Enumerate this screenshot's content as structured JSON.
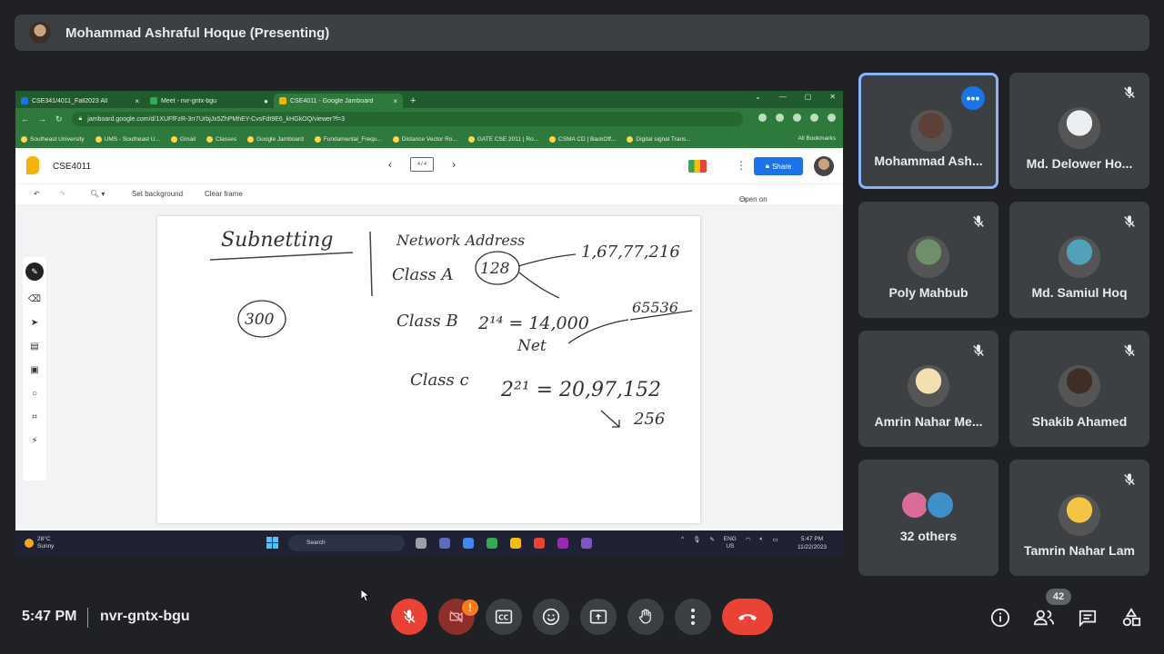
{
  "presenter": {
    "label": "Mohammad Ashraful Hoque (Presenting)"
  },
  "browser": {
    "tabs": [
      {
        "label": "CSE341/4011_Fall2023 All",
        "favicon_color": "#1a73e8",
        "active": false
      },
      {
        "label": "Meet - nvr-gntx-bgu",
        "favicon_color": "#34a853",
        "active": false
      },
      {
        "label": "CSE4011 - Google Jamboard",
        "favicon_color": "#f6b400",
        "active": true
      }
    ],
    "url": "jamboard.google.com/d/1XUFfFzR-3rr7UrbjJx5ZhPMhEY-CvsFdt9E6_kHGkOQ/viewer?f=3",
    "bookmarks": [
      "Southeast University",
      "UMS - Southeast U...",
      "Gmail",
      "Classes",
      "Google Jamboard",
      "Fundamental_Frequ...",
      "Distance Vector Ro...",
      "GATE CSE 2011 | Ro...",
      "CSMA CD | BackOff...",
      "Digital signal Trans..."
    ],
    "all_bookmarks": "All Bookmarks"
  },
  "jamboard": {
    "title": "CSE4011",
    "frame_indicator": "4 / 4",
    "share_label": "Share",
    "set_background": "Set background",
    "clear_frame": "Clear frame",
    "open_on_jamboard": "Open on a Jamboard",
    "board_text": {
      "subnetting": "Subnetting",
      "network_address": "Network Address",
      "class_a": "Class A",
      "class_a_value": "128",
      "class_a_hosts": "1,67,77,216",
      "circled_300": "300",
      "class_b": "Class B",
      "class_b_formula": "2¹⁴ = 14,000",
      "class_b_net": "Net",
      "class_b_hosts": "65536",
      "class_c": "Class c",
      "class_c_formula": "2²¹ = 20,97,152",
      "class_c_hosts": "256"
    }
  },
  "taskbar": {
    "weather_temp": "28°C",
    "weather_desc": "Sunny",
    "search_label": "Search",
    "lang": "ENG",
    "region": "US",
    "time": "5:47 PM",
    "date": "11/22/2023",
    "app_colors": [
      "#9aa0a6",
      "#5c6bc0",
      "#4285f4",
      "#34a853",
      "#fbbc04",
      "#ea4335",
      "#9c27b0",
      "#7e57c2"
    ]
  },
  "participants": [
    {
      "name": "Mohammad Ash...",
      "avatar_color": "#5d4037",
      "muted": false,
      "active": true
    },
    {
      "name": "Md. Delower Ho...",
      "avatar_color": "#eceff1",
      "muted": true,
      "active": false
    },
    {
      "name": "Poly Mahbub",
      "avatar_color": "#6d8f6a",
      "muted": true,
      "active": false
    },
    {
      "name": "Md. Samiul Hoq",
      "avatar_color": "#4fa3b8",
      "muted": true,
      "active": false
    },
    {
      "name": "Amrin Nahar Me...",
      "avatar_color": "#f2e0b0",
      "muted": true,
      "active": false
    },
    {
      "name": "Shakib Ahamed",
      "avatar_color": "#3e2f26",
      "muted": true,
      "active": false
    },
    {
      "name": "32 others",
      "avatar_color": "#d86b9a",
      "muted": false,
      "active": false
    },
    {
      "name": "Tamrin Nahar Lam",
      "avatar_color": "#f4c542",
      "muted": true,
      "active": false
    }
  ],
  "meeting": {
    "time": "5:47 PM",
    "code": "nvr-gntx-bgu",
    "people_count": "42",
    "warning_badge": "!"
  },
  "colors": {
    "background": "#202124",
    "tile": "#3c4043",
    "active_border": "#8ab4f8",
    "danger": "#ea4335",
    "warning": "#fa7b17"
  }
}
